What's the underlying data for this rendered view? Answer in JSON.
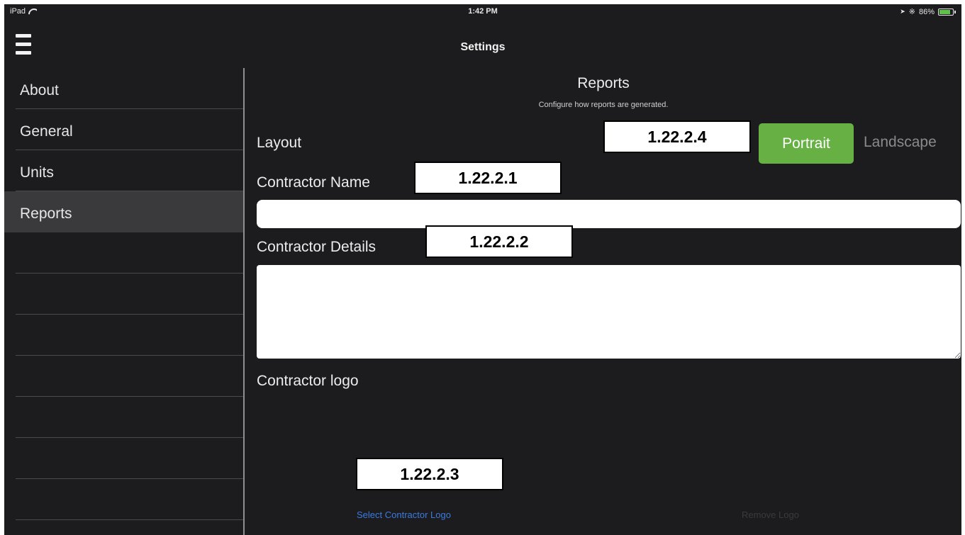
{
  "status_bar": {
    "device": "iPad",
    "time": "1:42 PM",
    "battery_percent": "86%",
    "battery_level": 0.86
  },
  "nav": {
    "title": "Settings"
  },
  "sidebar": {
    "items": [
      {
        "label": "About"
      },
      {
        "label": "General"
      },
      {
        "label": "Units"
      },
      {
        "label": "Reports"
      }
    ],
    "active": "Reports"
  },
  "main": {
    "title": "Reports",
    "subtitle": "Configure how reports are generated.",
    "layout_label": "Layout",
    "layout_options": [
      "Portrait",
      "Landscape"
    ],
    "layout_selected": "Portrait",
    "contractor_name_label": "Contractor Name",
    "contractor_name_value": "",
    "contractor_details_label": "Contractor Details",
    "contractor_details_value": "",
    "contractor_logo_label": "Contractor logo",
    "select_logo_link": "Select Contractor Logo",
    "remove_logo_link": "Remove Logo"
  },
  "callouts": {
    "layout": "1.22.2.4",
    "contractor_name": "1.22.2.1",
    "contractor_details": "1.22.2.2",
    "select_logo": "1.22.2.3"
  },
  "colors": {
    "background": "#1c1c1e",
    "accent_green": "#66b044",
    "link_blue": "#3a7be0",
    "sidebar_active": "#3a3a3c"
  }
}
